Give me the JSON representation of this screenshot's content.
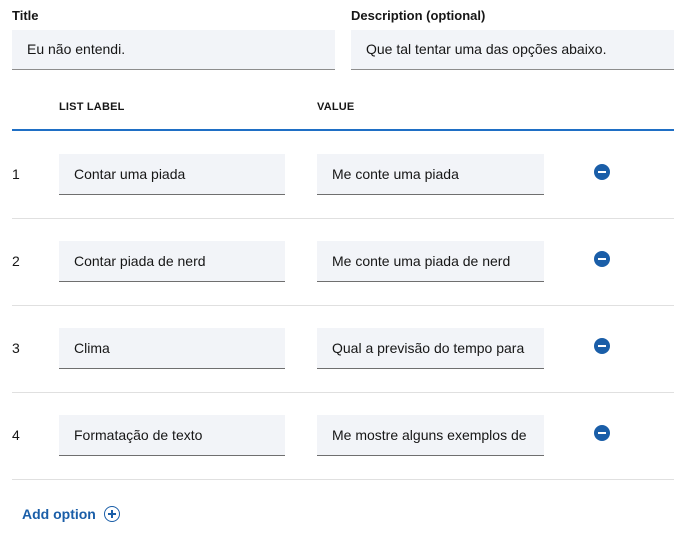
{
  "form": {
    "title_label": "Title",
    "title_value": "Eu não entendi.",
    "description_label": "Description (optional)",
    "description_value": "Que tal tentar uma das opções abaixo."
  },
  "table": {
    "headers": {
      "list_label": "LIST LABEL",
      "value": "VALUE"
    },
    "rows": [
      {
        "number": "1",
        "label": "Contar uma piada",
        "value": "Me conte uma piada"
      },
      {
        "number": "2",
        "label": "Contar piada de nerd",
        "value": "Me conte uma piada de nerd"
      },
      {
        "number": "3",
        "label": "Clima",
        "value": "Qual a previsão do tempo para"
      },
      {
        "number": "4",
        "label": "Formatação de texto",
        "value": "Me mostre alguns exemplos de"
      }
    ]
  },
  "actions": {
    "add_option_label": "Add option"
  },
  "icons": {
    "remove": "minus-circle-icon",
    "add": "plus-circle-icon"
  },
  "colors": {
    "accent": "#1a5ea8",
    "field_bg": "#f2f4f8",
    "divider": "#e0e0e0"
  }
}
